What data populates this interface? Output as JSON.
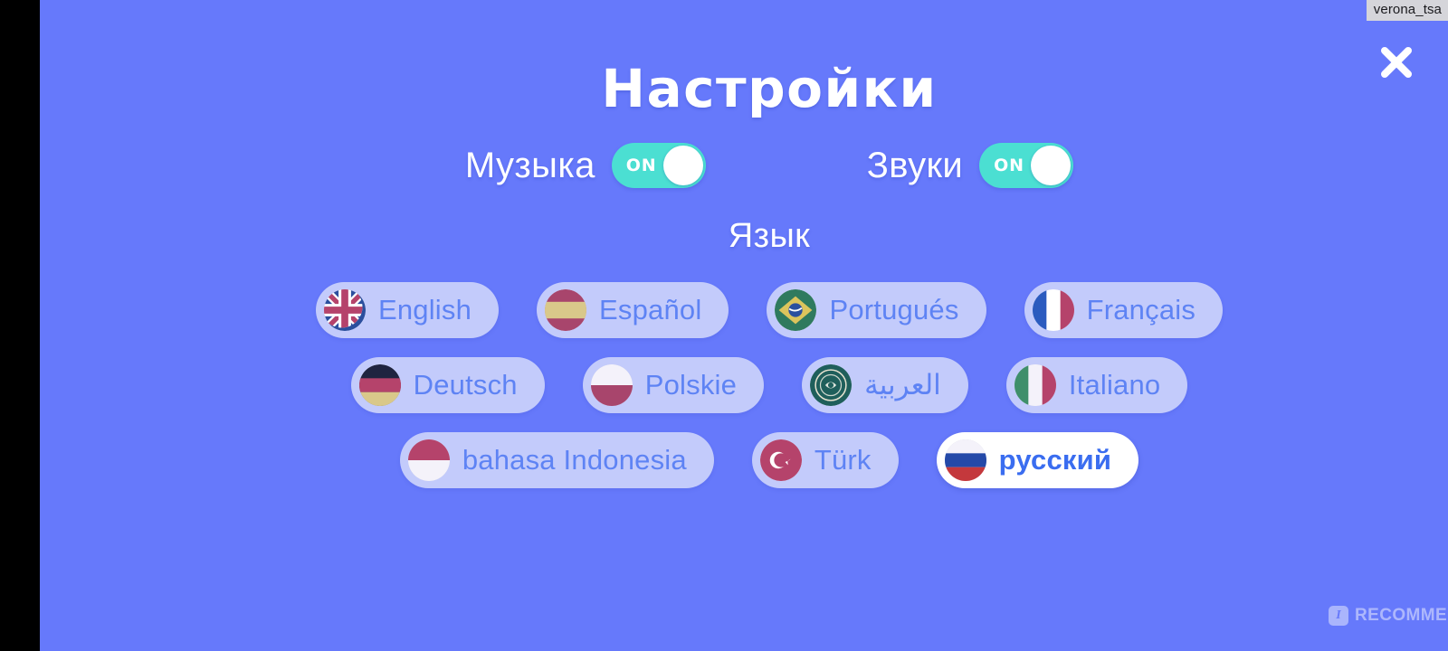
{
  "window": {
    "background_color": "#6679fb",
    "letterbox_color": "#000000",
    "user_tag": "verona_tsa"
  },
  "header": {
    "title": "Настройки",
    "close_icon": "close-x-icon"
  },
  "audio": {
    "items": [
      {
        "label": "Музыка",
        "state_label": "ON",
        "enabled": true
      },
      {
        "label": "Звуки",
        "state_label": "ON",
        "enabled": true
      }
    ],
    "track_color": "#4bdfd2",
    "knob_color": "#ffffff"
  },
  "language": {
    "heading": "Язык",
    "selected": "русский",
    "pill_color": "#c3cbfb",
    "pill_selected_color": "#ffffff",
    "text_color": "#5e83f4",
    "rows": [
      [
        {
          "label": "English",
          "flag": "flag-uk",
          "selected": false,
          "rtl": false
        },
        {
          "label": "Español",
          "flag": "flag-spain",
          "selected": false,
          "rtl": false
        },
        {
          "label": "Portugués",
          "flag": "flag-brazil",
          "selected": false,
          "rtl": false
        },
        {
          "label": "Français",
          "flag": "flag-france",
          "selected": false,
          "rtl": false
        }
      ],
      [
        {
          "label": "Deutsch",
          "flag": "flag-germany",
          "selected": false,
          "rtl": false
        },
        {
          "label": "Polskie",
          "flag": "flag-poland",
          "selected": false,
          "rtl": false
        },
        {
          "label": "العربية",
          "flag": "flag-arab-league",
          "selected": false,
          "rtl": true
        },
        {
          "label": "Italiano",
          "flag": "flag-italy",
          "selected": false,
          "rtl": false
        }
      ],
      [
        {
          "label": "bahasa Indonesia",
          "flag": "flag-indonesia",
          "selected": false,
          "rtl": false
        },
        {
          "label": "Türk",
          "flag": "flag-turkey",
          "selected": false,
          "rtl": false
        },
        {
          "label": "русский",
          "flag": "flag-russia",
          "selected": true,
          "rtl": false
        }
      ]
    ]
  },
  "watermark": {
    "badge": "I",
    "text": "RECOMMEND.RU"
  }
}
